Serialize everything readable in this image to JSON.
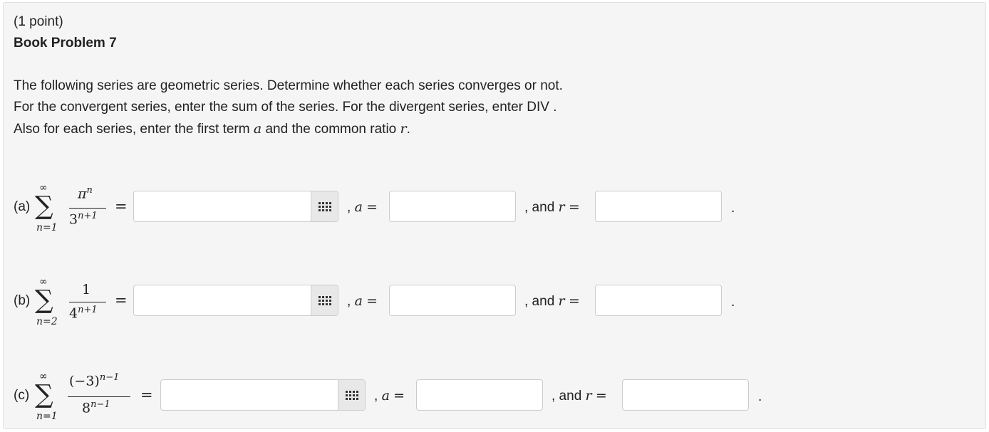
{
  "header": {
    "points": "(1 point)",
    "title": "Book Problem 7"
  },
  "instructions": {
    "line1": "The following series are geometric series. Determine whether each series converges or not.",
    "line2": "For the convergent series, enter the sum of the series. For the divergent series, enter DIV .",
    "line3_before": "Also for each series, enter the first term",
    "line3_a": "a",
    "line3_mid": "and the common ratio",
    "line3_r": "r",
    "line3_end": "."
  },
  "icons": {
    "palette": "grid-icon"
  },
  "labels": {
    "comma_a": ", ",
    "a_var": "a",
    "equals": "=",
    "and_text": ", and ",
    "r_var": "r",
    "period": "."
  },
  "problems": [
    {
      "label": "(a)",
      "sum_upper": "∞",
      "sum_lower": "n=1",
      "numerator_base": "π",
      "numerator_exp": "n",
      "denominator_base": "3",
      "denominator_exp": "n+1",
      "sum_value": "",
      "a_value": "",
      "r_value": ""
    },
    {
      "label": "(b)",
      "sum_upper": "∞",
      "sum_lower": "n=2",
      "numerator_base": "1",
      "numerator_exp": "",
      "denominator_base": "4",
      "denominator_exp": "n+1",
      "sum_value": "",
      "a_value": "",
      "r_value": ""
    },
    {
      "label": "(c)",
      "sum_upper": "∞",
      "sum_lower": "n=1",
      "numerator_base": "(−3)",
      "numerator_exp": "n−1",
      "denominator_base": "8",
      "denominator_exp": "n−1",
      "sum_value": "",
      "a_value": "",
      "r_value": ""
    }
  ]
}
